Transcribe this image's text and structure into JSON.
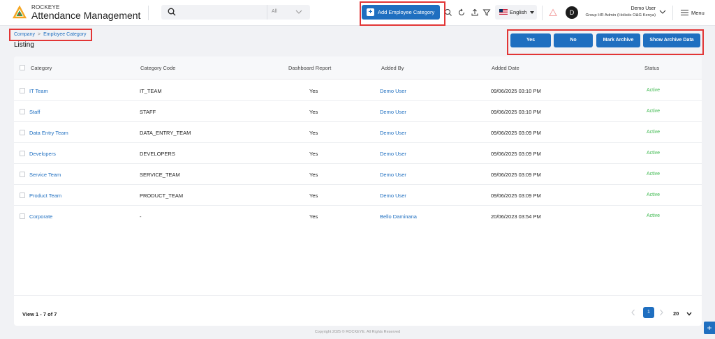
{
  "header": {
    "brand_top": "ROCKEYE",
    "brand_main": "Attendance Management",
    "search": {
      "placeholder": "",
      "filter_value": "All"
    },
    "add_button_label": "Add Employee Category",
    "language": "English",
    "user": {
      "avatar_letter": "D",
      "name": "Demo User",
      "role": "Group HR Admin (Holistic O&G Kenya)"
    },
    "menu_label": "Menu"
  },
  "breadcrumb": {
    "items": [
      "Company",
      "Employee Category"
    ]
  },
  "page_title": "Listing",
  "actions": {
    "yes": "Yes",
    "no": "No",
    "mark_archive": "Mark Archive",
    "show_archive": "Show Archive Data"
  },
  "table": {
    "columns": {
      "category": "Category",
      "code": "Category Code",
      "dashboard": "Dashboard Report",
      "added_by": "Added By",
      "added_date": "Added Date",
      "status": "Status"
    },
    "rows": [
      {
        "category": "IT Team",
        "code": "IT_TEAM",
        "dashboard": "Yes",
        "added_by": "Demo User",
        "added_date": "09/06/2025 03:10 PM",
        "status": "Active"
      },
      {
        "category": "Staff",
        "code": "STAFF",
        "dashboard": "Yes",
        "added_by": "Demo User",
        "added_date": "09/06/2025 03:10 PM",
        "status": "Active"
      },
      {
        "category": "Data Entry Team",
        "code": "DATA_ENTRY_TEAM",
        "dashboard": "Yes",
        "added_by": "Demo User",
        "added_date": "09/06/2025 03:09 PM",
        "status": "Active"
      },
      {
        "category": "Developers",
        "code": "DEVELOPERS",
        "dashboard": "Yes",
        "added_by": "Demo User",
        "added_date": "09/06/2025 03:09 PM",
        "status": "Active"
      },
      {
        "category": "Service Team",
        "code": "SERVICE_TEAM",
        "dashboard": "Yes",
        "added_by": "Demo User",
        "added_date": "09/06/2025 03:09 PM",
        "status": "Active"
      },
      {
        "category": "Product Team",
        "code": "PRODUCT_TEAM",
        "dashboard": "Yes",
        "added_by": "Demo User",
        "added_date": "09/06/2025 03:09 PM",
        "status": "Active"
      },
      {
        "category": "Corporate",
        "code": "-",
        "dashboard": "Yes",
        "added_by": "Bello Daminana",
        "added_date": "20/06/2023 03:54 PM",
        "status": "Active"
      }
    ]
  },
  "footer": {
    "view_count": "View 1 - 7 of 7",
    "current_page": "1",
    "per_page": "20"
  },
  "copyright": "Copyright 2025 © ROCKEYE. All Rights Reserved",
  "colors": {
    "primary": "#1f6fc0",
    "status_active": "#3fb950",
    "highlight": "#e23535"
  },
  "icons": [
    "rockeye-logo-icon",
    "search-icon",
    "chevron-down-icon",
    "plus-icon",
    "refresh-icon",
    "upload-icon",
    "filter-icon",
    "us-flag-icon",
    "alert-icon",
    "hamburger-menu-icon",
    "chevron-left-icon",
    "chevron-right-icon"
  ]
}
